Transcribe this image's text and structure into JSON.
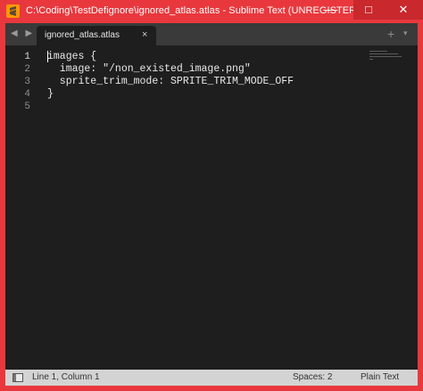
{
  "window": {
    "title": "C:\\Coding\\TestDefignore\\ignored_atlas.atlas - Sublime Text (UNREGISTERED)",
    "minimize_glyph": "—",
    "maximize_glyph": "□",
    "close_glyph": "✕",
    "accent_color": "#e8383d"
  },
  "tabbar": {
    "nav_glyph": "◀ ▶",
    "plus_glyph": "+",
    "chevron_glyph": "▾",
    "tabs": [
      {
        "label": "ignored_atlas.atlas",
        "close_glyph": "×"
      }
    ]
  },
  "editor": {
    "line_numbers": [
      "1",
      "2",
      "3",
      "4",
      "5"
    ],
    "lines": [
      "images {",
      "  image: \"/non_existed_image.png\"",
      "  sprite_trim_mode: SPRITE_TRIM_MODE_OFF",
      "}",
      ""
    ]
  },
  "statusbar": {
    "position": "Line 1, Column 1",
    "spaces": "Spaces: 2",
    "syntax": "Plain Text"
  }
}
